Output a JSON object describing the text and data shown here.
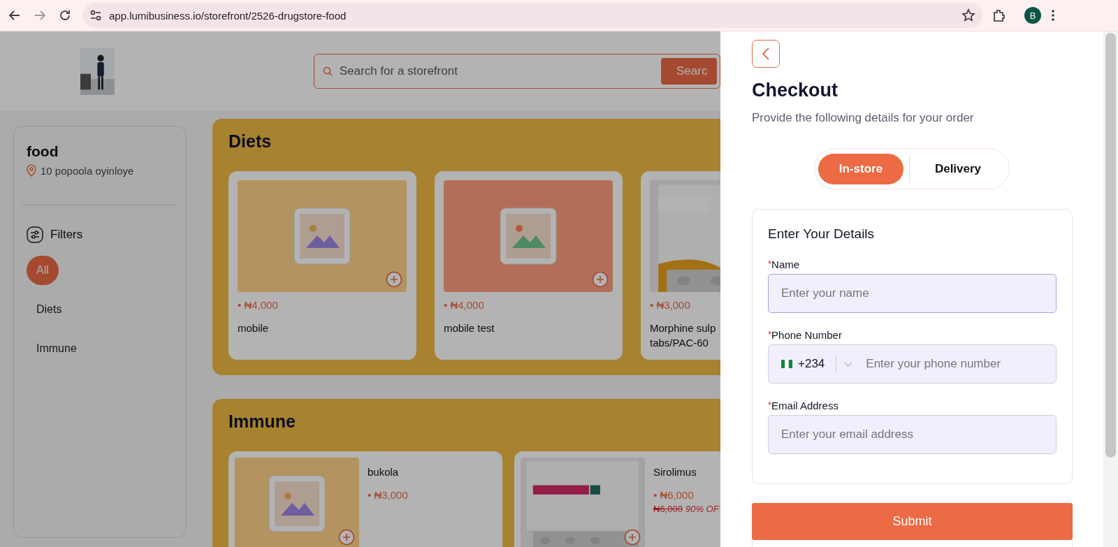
{
  "browser": {
    "url": "app.lumibusiness.io/storefront/2526-drugstore-food",
    "profile_initial": "B"
  },
  "header": {
    "search_placeholder": "Search for a storefront",
    "search_button": "Searc"
  },
  "sidebar": {
    "store_name": "food",
    "address": "10 popoola oyinloye",
    "filters_label": "Filters",
    "filters": [
      {
        "label": "All",
        "selected": true
      },
      {
        "label": "Diets",
        "selected": false
      },
      {
        "label": "Immune",
        "selected": false
      }
    ]
  },
  "sections": [
    {
      "title": "Diets",
      "products": [
        {
          "kind": "placeholder",
          "color": "#b3935f",
          "add_visible": true,
          "price": "• ₦4,000",
          "name_lines": [
            "mobile"
          ]
        },
        {
          "kind": "placeholder",
          "color": "#b36e5a",
          "add_visible": true,
          "price": "• ₦4,000",
          "name_lines": [
            "mobile test"
          ]
        },
        {
          "add_visible": false,
          "price": "• ₦3,000",
          "name_lines": [
            "Morphine sulp",
            "tabs/PAC-60"
          ]
        }
      ]
    },
    {
      "title": "Immune",
      "products": [
        {
          "kind": "placeholder",
          "color": "#b3935f",
          "add_visible": true,
          "price": "• ₦3,000",
          "name_lines": [
            "bukola"
          ]
        },
        {
          "add_visible": true,
          "price": "• ₦6,000",
          "old_price": "₦6,000",
          "discount": "90% OF",
          "name_lines": [
            "Sirolimus"
          ]
        }
      ]
    }
  ],
  "checkout": {
    "title": "Checkout",
    "subtitle": "Provide the following details for your order",
    "modes": [
      {
        "label": "In-store",
        "selected": true
      },
      {
        "label": "Delivery",
        "selected": false
      }
    ],
    "form": {
      "title": "Enter Your Details",
      "fields": [
        {
          "kind": "text",
          "marker": "*",
          "label": "Name",
          "placeholder": "Enter your name",
          "focused": true
        },
        {
          "kind": "phone",
          "marker": "*",
          "label": "Phone Number",
          "code": "+234",
          "placeholder": "Enter your phone number",
          "focused": false
        },
        {
          "kind": "text",
          "marker": "*",
          "label": "Email Address",
          "placeholder": "Enter your email address",
          "focused": false
        }
      ]
    },
    "submit": "Submit"
  }
}
